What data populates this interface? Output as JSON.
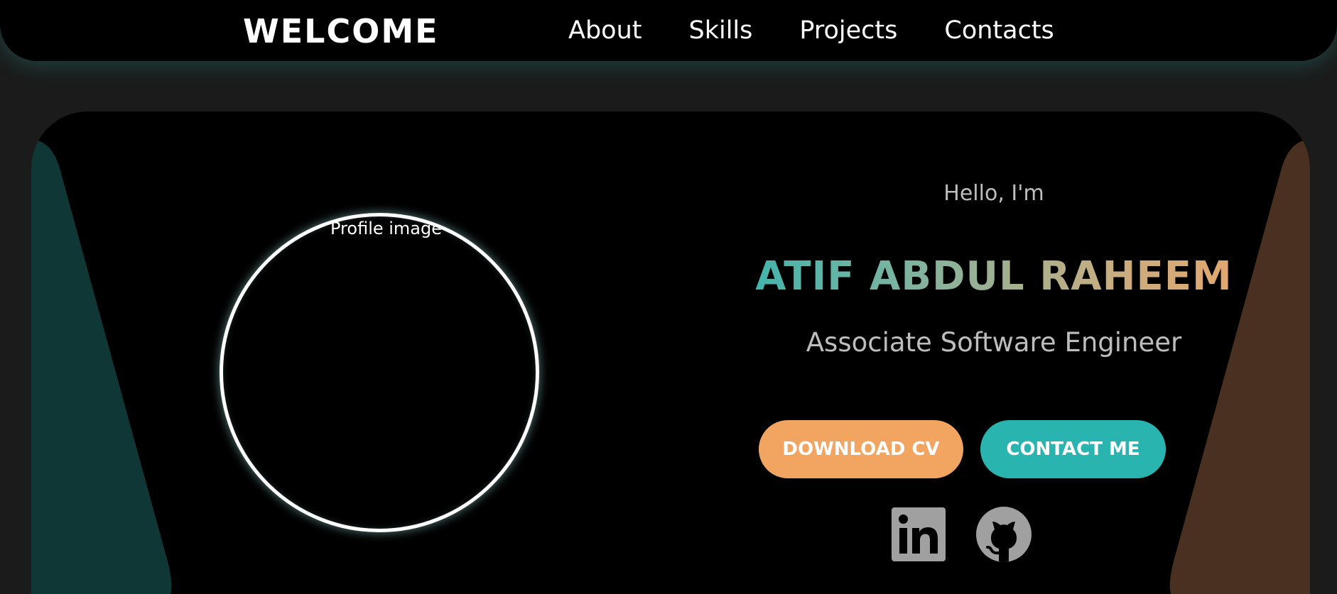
{
  "nav": {
    "brand": "WELCOME",
    "links": [
      "About",
      "Skills",
      "Projects",
      "Contacts"
    ]
  },
  "hero": {
    "profile_image_alt": "Profile image",
    "greeting": "Hello, I'm",
    "name": "ATIF ABDUL RAHEEM",
    "role": "Associate Software Engineer",
    "buttons": {
      "download_cv": "DOWNLOAD CV",
      "contact_me": "CONTACT ME"
    },
    "social_icons": [
      "linkedin-icon",
      "github-icon"
    ]
  },
  "colors": {
    "accent_teal": "#2ab4b0",
    "accent_orange": "#f2a461",
    "page_bg": "#1b1b1b",
    "panel_bg": "#000000",
    "deco_left": "#0f3736",
    "deco_right": "#4a3020",
    "icon_grey": "#a0a0a0"
  }
}
